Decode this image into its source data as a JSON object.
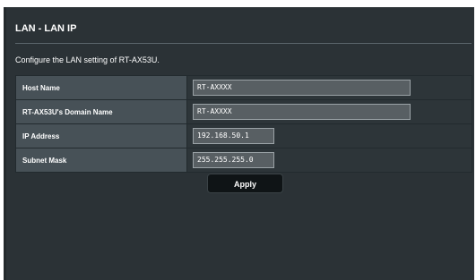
{
  "panel": {
    "title": "LAN - LAN IP",
    "description": "Configure the LAN setting of RT-AX53U."
  },
  "rows": [
    {
      "label": "Host Name",
      "value": "RT-AXXXX"
    },
    {
      "label": "RT-AX53U's Domain Name",
      "value": "RT-AXXXX"
    },
    {
      "label": "IP Address",
      "value": "192.168.50.1"
    },
    {
      "label": "Subnet Mask",
      "value": "255.255.255.0"
    }
  ],
  "actions": {
    "apply_label": "Apply"
  },
  "colors": {
    "panel_bg": "#2b3236",
    "label_bg": "#475157",
    "field_bg": "#585f63",
    "button_bg": "#0f1416"
  }
}
